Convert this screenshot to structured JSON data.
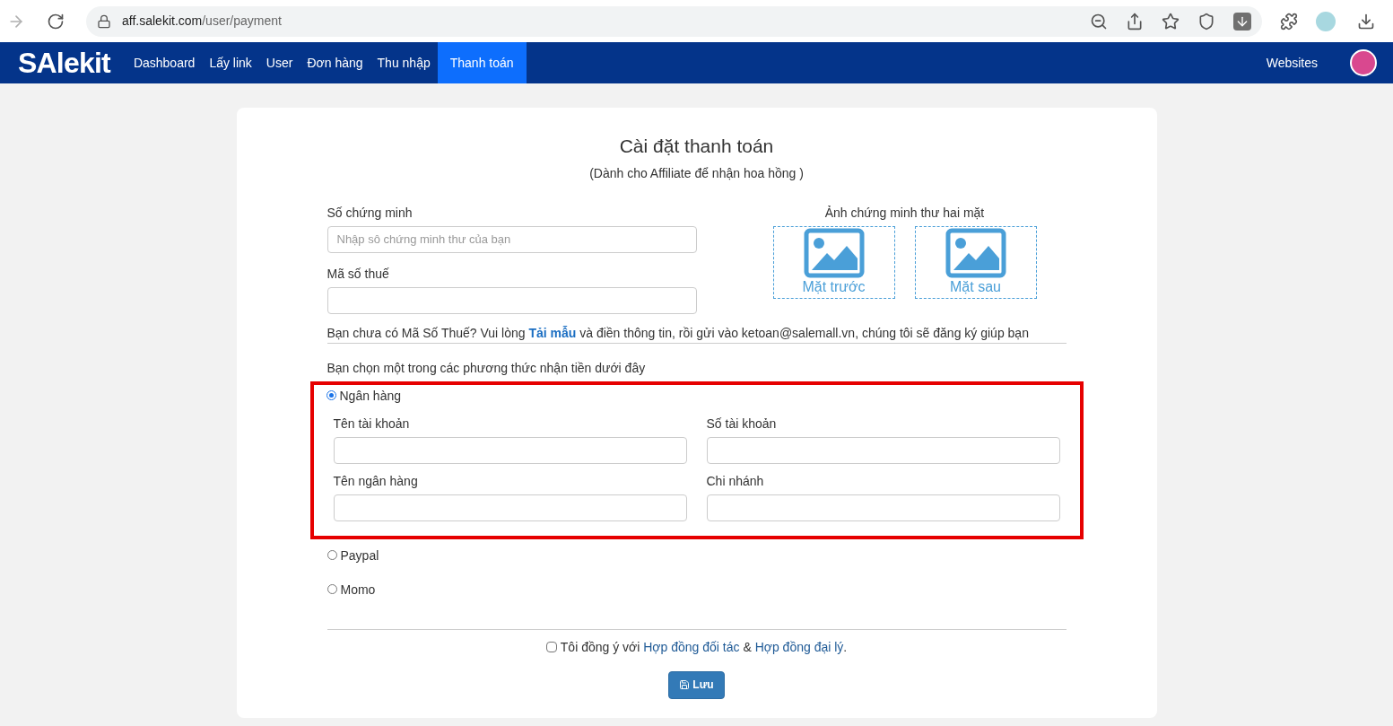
{
  "browser": {
    "url_host": "aff.salekit.com",
    "url_path": "/user/payment"
  },
  "nav": {
    "logo": "SAlekit",
    "items": [
      {
        "label": "Dashboard",
        "selected": false
      },
      {
        "label": "Lấy link",
        "selected": false
      },
      {
        "label": "User",
        "selected": false
      },
      {
        "label": "Đơn hàng",
        "selected": false
      },
      {
        "label": "Thu nhập",
        "selected": false
      },
      {
        "label": "Thanh toán",
        "selected": true
      }
    ],
    "right_link": "Websites"
  },
  "form": {
    "title": "Cài đặt thanh toán",
    "subtitle": "(Dành cho Affiliate để nhận hoa hồng )",
    "id_number": {
      "label": "Số chứng minh",
      "placeholder": "Nhập sô chứng minh thư của bạn"
    },
    "tax_code": {
      "label": "Mã số thuế"
    },
    "photos": {
      "label": "Ảnh chứng minh thư hai mặt",
      "slots": [
        "Mặt trước",
        "Mặt sau"
      ]
    },
    "tax_hint": {
      "before": "Bạn chưa có Mã Số Thuế? Vui lòng ",
      "link": "Tải mẫu",
      "after": " và điền thông tin, rồi gửi vào ketoan@salemall.vn, chúng tôi sẽ đăng ký giúp bạn"
    },
    "methods_label": "Bạn chọn một trong các phương thức nhận tiền dưới đây",
    "methods": [
      {
        "label": "Ngân hàng",
        "selected": true,
        "fields": [
          "Tên tài khoản",
          "Số tài khoản",
          "Tên ngân hàng",
          "Chi nhánh"
        ]
      },
      {
        "label": "Paypal",
        "selected": false
      },
      {
        "label": "Momo",
        "selected": false
      }
    ],
    "agreement": {
      "checked": false,
      "parts": [
        {
          "kind": "text",
          "text": "Tôi đồng ý với "
        },
        {
          "kind": "link",
          "text": "Hợp đồng đối tác"
        },
        {
          "kind": "text",
          "text": " & "
        },
        {
          "kind": "link",
          "text": "Hợp đồng đại lý"
        },
        {
          "kind": "text",
          "text": "."
        }
      ]
    },
    "save_button": "Lưu"
  }
}
